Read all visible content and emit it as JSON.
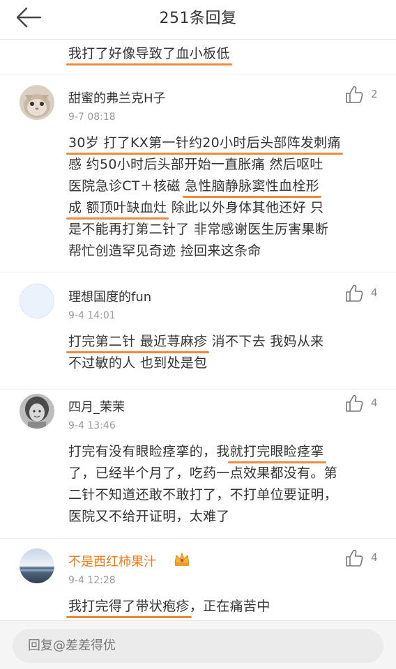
{
  "header": {
    "title": "251条回复"
  },
  "prev_comment": {
    "text": "我打了好像导致了血小板低"
  },
  "comments": [
    {
      "name": "甜蜜的弗兰克H子",
      "time": "9-7 08:18",
      "likes": "2",
      "line1": "30岁 打了KX第一针约20小时后头部阵发刺痛",
      "line2": "感 约50小时后头部开始一直胀痛 然后呕吐",
      "line3a": "医院急诊CT＋核磁 ",
      "line3b": "急性脑静脉窦性血栓形",
      "line4a": "成 额顶叶缺血灶",
      "line4b": " 除此以外身体其他还好 只",
      "line5": "是不能再打第二针了 非常感谢医生厉害果断",
      "line6": "帮忙创造罕见奇迹 捡回来这条命"
    },
    {
      "name": "理想国度的fun",
      "time": "9-4 14:01",
      "likes": "4",
      "line1a": "打完第二针 最近荨麻疹",
      "line1b": " 消不下去 我妈从来",
      "line2": "不过敏的人 也到处是包"
    },
    {
      "name": "四月_茉茉",
      "time": "9-4 13:46",
      "likes": "4",
      "line1a": "打完有没有眼睑痉挛的，我",
      "line1b": "就打完眼睑痉挛",
      "line2": "了，已经半个月了，吃药一点效果都没有。第",
      "line3": "二针不知道还敢不敢打了，不打单位要证明，",
      "line4": "医院又不给开证明，太难了"
    },
    {
      "name": "不是西红柿果汁",
      "time": "9-4 12:28",
      "likes": "4",
      "line1a": "我打完得了带状疱疹",
      "line1b": "，正在痛苦中"
    }
  ],
  "reply": {
    "placeholder": "回复@差差得优"
  },
  "colors": {
    "underline": "#f08a3a",
    "vip_name": "#ef7a1a"
  }
}
